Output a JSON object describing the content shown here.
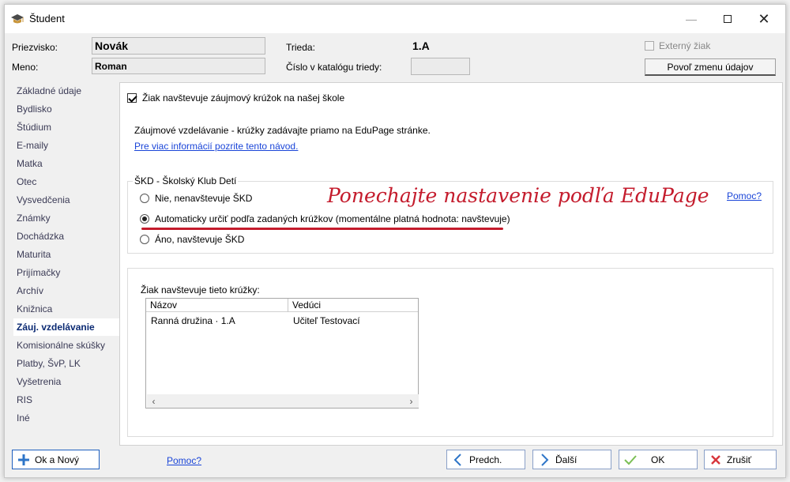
{
  "window": {
    "title": "Študent"
  },
  "header": {
    "surname_label": "Priezvisko:",
    "surname_value": "Novák",
    "name_label": "Meno:",
    "name_value": "Roman",
    "class_label": "Trieda:",
    "class_value": "1.A",
    "catalog_label": "Číslo v katalógu triedy:",
    "catalog_value": "",
    "external_label": "Externý žiak",
    "allow_change_label": "Povoľ zmenu údajov"
  },
  "sidebar": {
    "items": [
      {
        "label": "Základné údaje"
      },
      {
        "label": "Bydlisko"
      },
      {
        "label": "Štúdium"
      },
      {
        "label": "E-maily"
      },
      {
        "label": "Matka"
      },
      {
        "label": "Otec"
      },
      {
        "label": "Vysvedčenia"
      },
      {
        "label": "Známky"
      },
      {
        "label": "Dochádzka"
      },
      {
        "label": "Maturita"
      },
      {
        "label": "Prijímačky"
      },
      {
        "label": "Archív"
      },
      {
        "label": "Knižnica"
      },
      {
        "label": "Záuj. vzdelávanie"
      },
      {
        "label": "Komisionálne skúšky"
      },
      {
        "label": "Platby, ŠvP, LK"
      },
      {
        "label": "Vyšetrenia"
      },
      {
        "label": "RIS"
      },
      {
        "label": "Iné"
      }
    ],
    "active_index": 13
  },
  "main": {
    "attends_circle_label": "Žiak navštevuje záujmový krúžok na našej škole",
    "info_text": "Záujmové vzdelávanie - krúžky zadávajte priamo na EduPage stránke.",
    "info_link": "Pre viac informácií pozrite tento návod.",
    "skd_group": {
      "legend": "ŠKD - Školský Klub Detí",
      "help_link": "Pomoc?",
      "options": [
        {
          "label": "Nie, nenavštevuje ŠKD",
          "selected": false
        },
        {
          "label": "Automaticky určiť podľa zadaných krúžkov (momentálne platná hodnota: navštevuje)",
          "selected": true
        },
        {
          "label": "Áno, navštevuje ŠKD",
          "selected": false
        }
      ]
    },
    "annotation": "Ponechajte nastavenie podľa EduPage",
    "circles_group": {
      "label": "Žiak navštevuje tieto krúžky:",
      "columns": [
        "Názov",
        "Vedúci"
      ],
      "rows": [
        [
          "Ranná družina · 1.A",
          "Učiteľ Testovací"
        ]
      ]
    }
  },
  "footer": {
    "ok_new_label": "Ok a Nový",
    "help_link": "Pomoc?",
    "prev_label": "Predch.",
    "next_label": "Ďalší",
    "ok_label": "OK",
    "cancel_label": "Zrušiť"
  },
  "colors": {
    "annotation_red": "#c41b2c",
    "link_blue": "#1a45d8",
    "active_nav": "#0b2a73"
  }
}
